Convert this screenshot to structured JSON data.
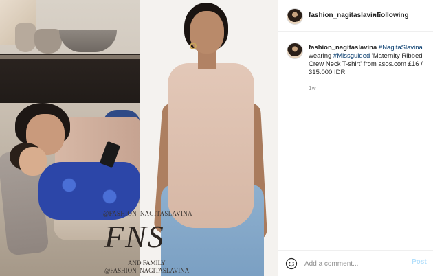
{
  "header": {
    "username": "fashion_nagitaslavina",
    "separator": "•",
    "follow_status": "Following"
  },
  "caption": {
    "username": "fashion_nagitaslavina",
    "mention": "#NagitaSlavina",
    "text_1": "wearing",
    "hashtag": "#Missguided",
    "text_2": "'Maternity Ribbed Crew Neck T-shirt' from asos.com £16 / 315.000 IDR",
    "time": "1w"
  },
  "watermark": {
    "handle_top": "@FASHION_NAGITASLAVINA",
    "logo": "FNS",
    "subtitle": "AND FAMILY",
    "handle_bottom": "@FASHION_NAGITASLAVINA"
  },
  "comment_box": {
    "placeholder": "Add a comment...",
    "post_label": "Post"
  },
  "colors": {
    "link": "#00376b",
    "post_disabled": "#b2dffc",
    "muted": "#8e8e8e"
  },
  "icons": [
    "avatar",
    "smile-icon"
  ]
}
